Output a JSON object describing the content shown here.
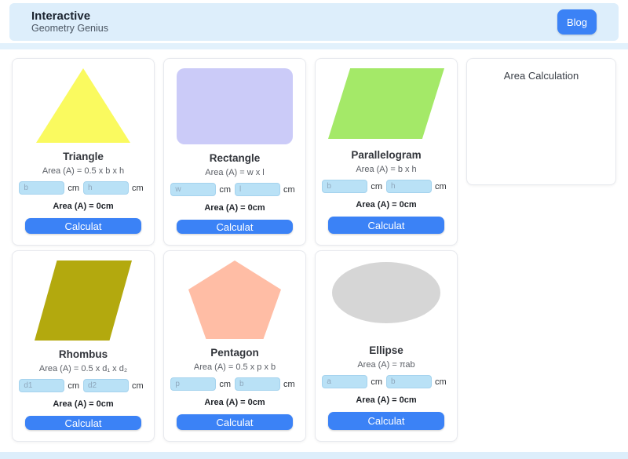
{
  "header": {
    "title": "Interactive",
    "subtitle": "Geometry Genius",
    "blog_label": "Blog"
  },
  "panel": {
    "title": "Area Calculation"
  },
  "cards": [
    {
      "title": "Triangle",
      "shape": "triangle",
      "shape_color": "#fafa5f",
      "formula": "Area (A) = 0.5 x b x h",
      "inputs": [
        {
          "placeholder": "b",
          "unit": "cm"
        },
        {
          "placeholder": "h",
          "unit": "cm"
        }
      ],
      "result": "Area (A) = 0cm",
      "button_label": "Calculat"
    },
    {
      "title": "Rectangle",
      "shape": "rectangle",
      "shape_color": "#cbcbf8",
      "formula": "Area (A) = w x l",
      "inputs": [
        {
          "placeholder": "w",
          "unit": "cm"
        },
        {
          "placeholder": "l",
          "unit": "cm"
        }
      ],
      "result": "Area (A) = 0cm",
      "button_label": "Calculat"
    },
    {
      "title": "Parallelogram",
      "shape": "parallelogram",
      "shape_color": "#a4e968",
      "formula": "Area (A) = b x h",
      "inputs": [
        {
          "placeholder": "b",
          "unit": "cm"
        },
        {
          "placeholder": "h",
          "unit": "cm"
        }
      ],
      "result": "Area (A) = 0cm",
      "button_label": "Calculat"
    },
    {
      "title": "Rhombus",
      "shape": "rhombus",
      "shape_color": "#b3a90e",
      "formula": "Area (A) = 0.5 x d₁ x d₂",
      "inputs": [
        {
          "placeholder": "d1",
          "unit": "cm"
        },
        {
          "placeholder": "d2",
          "unit": "cm"
        }
      ],
      "result": "Area (A) = 0cm",
      "button_label": "Calculat"
    },
    {
      "title": "Pentagon",
      "shape": "pentagon",
      "shape_color": "#ffbda5",
      "formula": "Area (A) = 0.5 x p x b",
      "inputs": [
        {
          "placeholder": "p",
          "unit": "cm"
        },
        {
          "placeholder": "b",
          "unit": "cm"
        }
      ],
      "result": "Area (A) = 0cm",
      "button_label": "Calculat"
    },
    {
      "title": "Ellipse",
      "shape": "ellipse",
      "shape_color": "#d6d6d6",
      "formula": "Area (A) = πab",
      "inputs": [
        {
          "placeholder": "a",
          "unit": "cm"
        },
        {
          "placeholder": "b",
          "unit": "cm"
        }
      ],
      "result": "Area (A) = 0cm",
      "button_label": "Calculat"
    }
  ],
  "colors": {
    "accent": "#3b82f6",
    "header_bg": "#ddeefb",
    "input_bg": "#b9e1f6"
  }
}
